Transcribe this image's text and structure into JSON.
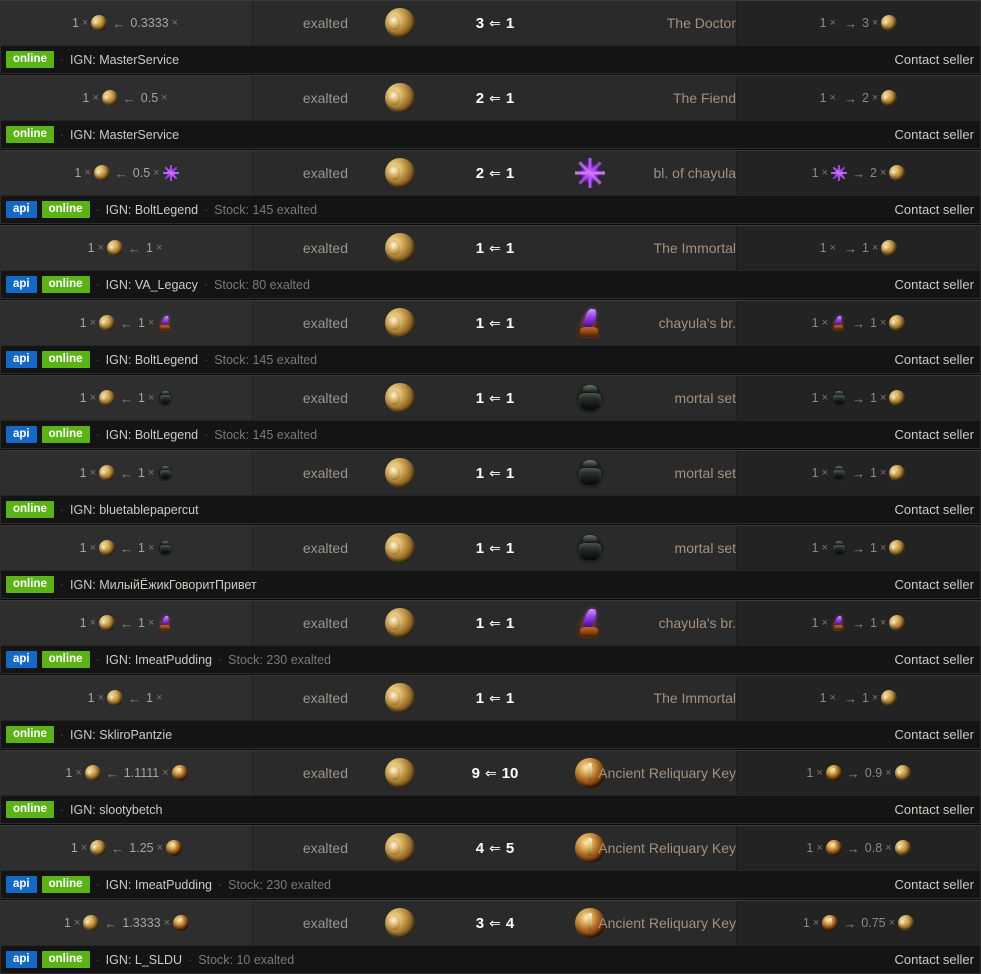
{
  "labels": {
    "contact_seller": "Contact seller",
    "ign_prefix": "IGN:",
    "stock_prefix": "Stock:",
    "badge_api": "api",
    "badge_online": "online",
    "times": "×",
    "arrow_left": "←",
    "arrow_right": "→",
    "arrow_left_double": "⇐",
    "separator": "·"
  },
  "colors": {
    "badge_api": "#1668c6",
    "badge_online": "#5cb317",
    "item_name": "#a39180",
    "ratio": "#ffffff",
    "row_main_bg": "#2a2a2a",
    "row_meta_bg": "#141414",
    "page_bg": "#0b0b0b"
  },
  "rows": [
    {
      "price": {
        "have_qty": "1",
        "have_icon": "exalted",
        "pay_qty": "0.3333",
        "pay_icon": null
      },
      "currency_name": "exalted",
      "currency_icon": "exalted",
      "ratio_left": "3",
      "ratio_right": "1",
      "item_icon": null,
      "item_name": "The Doctor",
      "right": {
        "left_qty": "1",
        "left_icon": null,
        "right_qty": "3",
        "right_icon": "exalted"
      },
      "meta": {
        "api": false,
        "online": true,
        "ign": "MasterService",
        "stock": null
      }
    },
    {
      "price": {
        "have_qty": "1",
        "have_icon": "exalted",
        "pay_qty": "0.5",
        "pay_icon": null
      },
      "currency_name": "exalted",
      "currency_icon": "exalted",
      "ratio_left": "2",
      "ratio_right": "1",
      "item_icon": null,
      "item_name": "The Fiend",
      "right": {
        "left_qty": "1",
        "left_icon": null,
        "right_qty": "2",
        "right_icon": "exalted"
      },
      "meta": {
        "api": false,
        "online": true,
        "ign": "MasterService",
        "stock": null
      }
    },
    {
      "price": {
        "have_qty": "1",
        "have_icon": "exalted",
        "pay_qty": "0.5",
        "pay_icon": "blessing"
      },
      "currency_name": "exalted",
      "currency_icon": "exalted",
      "ratio_left": "2",
      "ratio_right": "1",
      "item_icon": "blessing",
      "item_name": "bl. of chayula",
      "right": {
        "left_qty": "1",
        "left_icon": "blessing",
        "right_qty": "2",
        "right_icon": "exalted"
      },
      "meta": {
        "api": true,
        "online": true,
        "ign": "BoltLegend",
        "stock": "145 exalted"
      }
    },
    {
      "price": {
        "have_qty": "1",
        "have_icon": "exalted",
        "pay_qty": "1",
        "pay_icon": null
      },
      "currency_name": "exalted",
      "currency_icon": "exalted",
      "ratio_left": "1",
      "ratio_right": "1",
      "item_icon": null,
      "item_name": "The Immortal",
      "right": {
        "left_qty": "1",
        "left_icon": null,
        "right_qty": "1",
        "right_icon": "exalted"
      },
      "meta": {
        "api": true,
        "online": true,
        "ign": "VA_Legacy",
        "stock": "80 exalted"
      }
    },
    {
      "price": {
        "have_qty": "1",
        "have_icon": "exalted",
        "pay_qty": "1",
        "pay_icon": "breachstone"
      },
      "currency_name": "exalted",
      "currency_icon": "exalted",
      "ratio_left": "1",
      "ratio_right": "1",
      "item_icon": "breachstone",
      "item_name": "chayula's br.",
      "right": {
        "left_qty": "1",
        "left_icon": "breachstone",
        "right_qty": "1",
        "right_icon": "exalted"
      },
      "meta": {
        "api": true,
        "online": true,
        "ign": "BoltLegend",
        "stock": "145 exalted"
      }
    },
    {
      "price": {
        "have_qty": "1",
        "have_icon": "exalted",
        "pay_qty": "1",
        "pay_icon": "mortalset"
      },
      "currency_name": "exalted",
      "currency_icon": "exalted",
      "ratio_left": "1",
      "ratio_right": "1",
      "item_icon": "mortalset",
      "item_name": "mortal set",
      "right": {
        "left_qty": "1",
        "left_icon": "mortalset",
        "right_qty": "1",
        "right_icon": "exalted"
      },
      "meta": {
        "api": true,
        "online": true,
        "ign": "BoltLegend",
        "stock": "145 exalted"
      }
    },
    {
      "price": {
        "have_qty": "1",
        "have_icon": "exalted",
        "pay_qty": "1",
        "pay_icon": "mortalset"
      },
      "currency_name": "exalted",
      "currency_icon": "exalted",
      "ratio_left": "1",
      "ratio_right": "1",
      "item_icon": "mortalset",
      "item_name": "mortal set",
      "right": {
        "left_qty": "1",
        "left_icon": "mortalset",
        "right_qty": "1",
        "right_icon": "exalted"
      },
      "meta": {
        "api": false,
        "online": true,
        "ign": "bluetablepapercut",
        "stock": null
      }
    },
    {
      "price": {
        "have_qty": "1",
        "have_icon": "exalted",
        "pay_qty": "1",
        "pay_icon": "mortalset"
      },
      "currency_name": "exalted",
      "currency_icon": "exalted",
      "ratio_left": "1",
      "ratio_right": "1",
      "item_icon": "mortalset",
      "item_name": "mortal set",
      "right": {
        "left_qty": "1",
        "left_icon": "mortalset",
        "right_qty": "1",
        "right_icon": "exalted"
      },
      "meta": {
        "api": false,
        "online": true,
        "ign": "МилыйЁжикГоворитПривет",
        "stock": null
      }
    },
    {
      "price": {
        "have_qty": "1",
        "have_icon": "exalted",
        "pay_qty": "1",
        "pay_icon": "breachstone"
      },
      "currency_name": "exalted",
      "currency_icon": "exalted",
      "ratio_left": "1",
      "ratio_right": "1",
      "item_icon": "breachstone",
      "item_name": "chayula's br.",
      "right": {
        "left_qty": "1",
        "left_icon": "breachstone",
        "right_qty": "1",
        "right_icon": "exalted"
      },
      "meta": {
        "api": true,
        "online": true,
        "ign": "ImeatPudding",
        "stock": "230 exalted"
      }
    },
    {
      "price": {
        "have_qty": "1",
        "have_icon": "exalted",
        "pay_qty": "1",
        "pay_icon": null
      },
      "currency_name": "exalted",
      "currency_icon": "exalted",
      "ratio_left": "1",
      "ratio_right": "1",
      "item_icon": null,
      "item_name": "The Immortal",
      "right": {
        "left_qty": "1",
        "left_icon": null,
        "right_qty": "1",
        "right_icon": "exalted"
      },
      "meta": {
        "api": false,
        "online": true,
        "ign": "SkliroPantzie",
        "stock": null
      }
    },
    {
      "price": {
        "have_qty": "1",
        "have_icon": "exalted",
        "pay_qty": "1.1111",
        "pay_icon": "relkey"
      },
      "currency_name": "exalted",
      "currency_icon": "exalted",
      "ratio_left": "9",
      "ratio_right": "10",
      "item_icon": "relkey",
      "item_name": "Ancient Reliquary Key",
      "right": {
        "left_qty": "1",
        "left_icon": "relkey",
        "right_qty": "0.9",
        "right_icon": "exalted"
      },
      "meta": {
        "api": false,
        "online": true,
        "ign": "slootybetch",
        "stock": null
      }
    },
    {
      "price": {
        "have_qty": "1",
        "have_icon": "exalted",
        "pay_qty": "1.25",
        "pay_icon": "relkey"
      },
      "currency_name": "exalted",
      "currency_icon": "exalted",
      "ratio_left": "4",
      "ratio_right": "5",
      "item_icon": "relkey",
      "item_name": "Ancient Reliquary Key",
      "right": {
        "left_qty": "1",
        "left_icon": "relkey",
        "right_qty": "0.8",
        "right_icon": "exalted"
      },
      "meta": {
        "api": true,
        "online": true,
        "ign": "ImeatPudding",
        "stock": "230 exalted"
      }
    },
    {
      "price": {
        "have_qty": "1",
        "have_icon": "exalted",
        "pay_qty": "1.3333",
        "pay_icon": "relkey"
      },
      "currency_name": "exalted",
      "currency_icon": "exalted",
      "ratio_left": "3",
      "ratio_right": "4",
      "item_icon": "relkey",
      "item_name": "Ancient Reliquary Key",
      "right": {
        "left_qty": "1",
        "left_icon": "relkey",
        "right_qty": "0.75",
        "right_icon": "exalted"
      },
      "meta": {
        "api": true,
        "online": true,
        "ign": "L_SLDU",
        "stock": "10 exalted"
      }
    }
  ]
}
